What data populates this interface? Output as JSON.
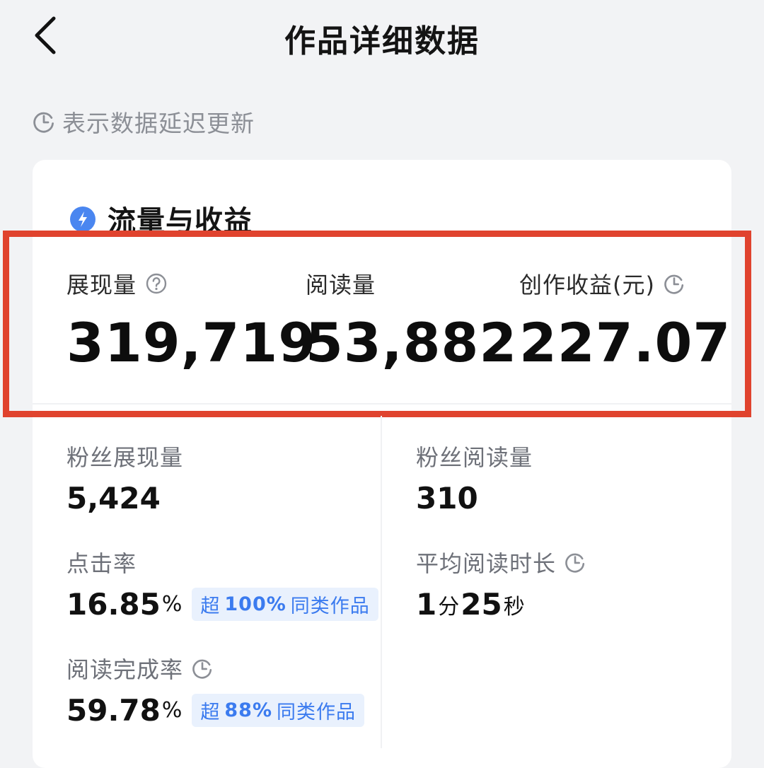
{
  "header": {
    "title": "作品详细数据"
  },
  "notice": {
    "delay_text": "表示数据延迟更新"
  },
  "section": {
    "title": "流量与收益"
  },
  "metrics": [
    {
      "label": "展现量",
      "value": "319,719"
    },
    {
      "label": "阅读量",
      "value": "53,882"
    },
    {
      "label": "创作收益(元)",
      "value": "227.07"
    }
  ],
  "stats": {
    "fan_impressions": {
      "label": "粉丝展现量",
      "value": "5,424"
    },
    "fan_reads": {
      "label": "粉丝阅读量",
      "value": "310"
    },
    "ctr": {
      "label": "点击率",
      "value": "16.85",
      "unit": "%",
      "badge_prefix": "超",
      "badge_value": "100%",
      "badge_suffix": "同类作品"
    },
    "avg_read_time": {
      "label": "平均阅读时长",
      "minutes": "1",
      "minutes_unit": "分",
      "seconds": "25",
      "seconds_unit": "秒"
    },
    "completion": {
      "label": "阅读完成率",
      "value": "59.78",
      "unit": "%",
      "badge_prefix": "超",
      "badge_value": "88%",
      "badge_suffix": "同类作品"
    }
  },
  "colors": {
    "highlight_border": "#e0432e",
    "accent_blue": "#3b7bef",
    "badge_bg": "#e9f1fd"
  },
  "icons": {
    "back": "chevron-left-icon",
    "clock": "clock-icon",
    "section": "lightning-drop-icon",
    "help": "question-circle-icon"
  }
}
